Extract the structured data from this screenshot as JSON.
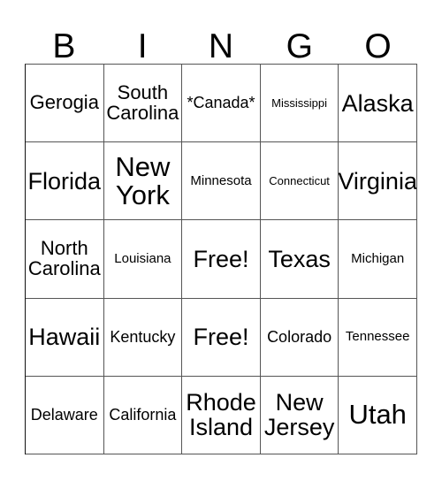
{
  "card": {
    "title_letters": [
      "B",
      "I",
      "N",
      "G",
      "O"
    ],
    "columns": 5,
    "rows": 5,
    "free_space_label": "Free!",
    "colors": {
      "background": "#ffffff",
      "cell_background": "#ffffff",
      "border": "#555555",
      "text": "#000000"
    },
    "cells": [
      [
        {
          "label": "Gerogia",
          "size": "lg"
        },
        {
          "label": "South\nCarolina",
          "size": "lg"
        },
        {
          "label": "*Canada*",
          "size": "md"
        },
        {
          "label": "Mississippi",
          "size": "xs"
        },
        {
          "label": "Alaska",
          "size": "xl"
        }
      ],
      [
        {
          "label": "Florida",
          "size": "xl"
        },
        {
          "label": "New\nYork",
          "size": "xxl"
        },
        {
          "label": "Minnesota",
          "size": "sm"
        },
        {
          "label": "Connecticut",
          "size": "xs"
        },
        {
          "label": "Virginia",
          "size": "xl"
        }
      ],
      [
        {
          "label": "North\nCarolina",
          "size": "lg"
        },
        {
          "label": "Louisiana",
          "size": "sm"
        },
        {
          "label": "Free!",
          "size": "xl"
        },
        {
          "label": "Texas",
          "size": "xl"
        },
        {
          "label": "Michigan",
          "size": "sm"
        }
      ],
      [
        {
          "label": "Hawaii",
          "size": "xl"
        },
        {
          "label": "Kentucky",
          "size": "md"
        },
        {
          "label": "Free!",
          "size": "xl"
        },
        {
          "label": "Colorado",
          "size": "md"
        },
        {
          "label": "Tennessee",
          "size": "sm"
        }
      ],
      [
        {
          "label": "Delaware",
          "size": "md"
        },
        {
          "label": "California",
          "size": "md"
        },
        {
          "label": "Rhode\nIsland",
          "size": "xl"
        },
        {
          "label": "New\nJersey",
          "size": "xl"
        },
        {
          "label": "Utah",
          "size": "xxl"
        }
      ]
    ]
  }
}
